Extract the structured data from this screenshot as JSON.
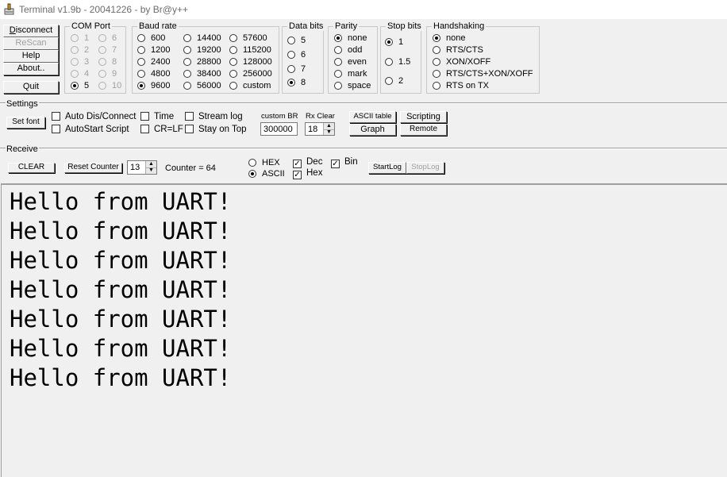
{
  "window": {
    "title": "Terminal v1.9b - 20041226 - by Br@y++",
    "icon": "terminal-app-icon"
  },
  "left_buttons": {
    "disconnect": "Disconnect",
    "rescan": "ReScan",
    "help": "Help",
    "about": "About..",
    "quit": "Quit"
  },
  "com_port": {
    "title": "COM Port",
    "options": [
      "1",
      "2",
      "3",
      "4",
      "5",
      "6",
      "7",
      "8",
      "9",
      "10"
    ],
    "selected": "5"
  },
  "baud_rate": {
    "title": "Baud rate",
    "options": [
      "600",
      "1200",
      "2400",
      "4800",
      "9600",
      "14400",
      "19200",
      "28800",
      "38400",
      "56000",
      "57600",
      "115200",
      "128000",
      "256000",
      "custom"
    ],
    "selected": "9600"
  },
  "data_bits": {
    "title": "Data bits",
    "options": [
      "5",
      "6",
      "7",
      "8"
    ],
    "selected": "8"
  },
  "parity": {
    "title": "Parity",
    "options": [
      "none",
      "odd",
      "even",
      "mark",
      "space"
    ],
    "selected": "none"
  },
  "stop_bits": {
    "title": "Stop bits",
    "options": [
      "1",
      "1.5",
      "2"
    ],
    "selected": "1"
  },
  "handshaking": {
    "title": "Handshaking",
    "options": [
      "none",
      "RTS/CTS",
      "XON/XOFF",
      "RTS/CTS+XON/XOFF",
      "RTS on TX"
    ],
    "selected": "none"
  },
  "settings": {
    "label": "Settings",
    "set_font": "Set font",
    "auto_dis_connect": "Auto Dis/Connect",
    "autostart_script": "AutoStart Script",
    "time": "Time",
    "cr_lf": "CR=LF",
    "stream_log": "Stream log",
    "stay_on_top": "Stay on Top",
    "custom_br_label": "custom BR",
    "custom_br_value": "300000",
    "rx_clear_label": "Rx Clear",
    "rx_clear_value": "18",
    "ascii_table": "ASCII table",
    "graph": "Graph",
    "scripting": "Scripting",
    "remote": "Remote"
  },
  "receive": {
    "label": "Receive",
    "clear": "CLEAR",
    "reset_counter": "Reset Counter",
    "counter_spin_value": "13",
    "counter_label": "Counter = ",
    "counter_value": "64",
    "hex": "HEX",
    "ascii": "ASCII",
    "mode_selected": "ASCII",
    "dec": "Dec",
    "hex_chk": "Hex",
    "bin": "Bin",
    "startlog": "StartLog",
    "stoplog": "StopLog",
    "lines": [
      "Hello from UART!",
      "Hello from UART!",
      "Hello from UART!",
      "Hello from UART!",
      "Hello from UART!",
      "Hello from UART!",
      "Hello from UART!"
    ]
  }
}
